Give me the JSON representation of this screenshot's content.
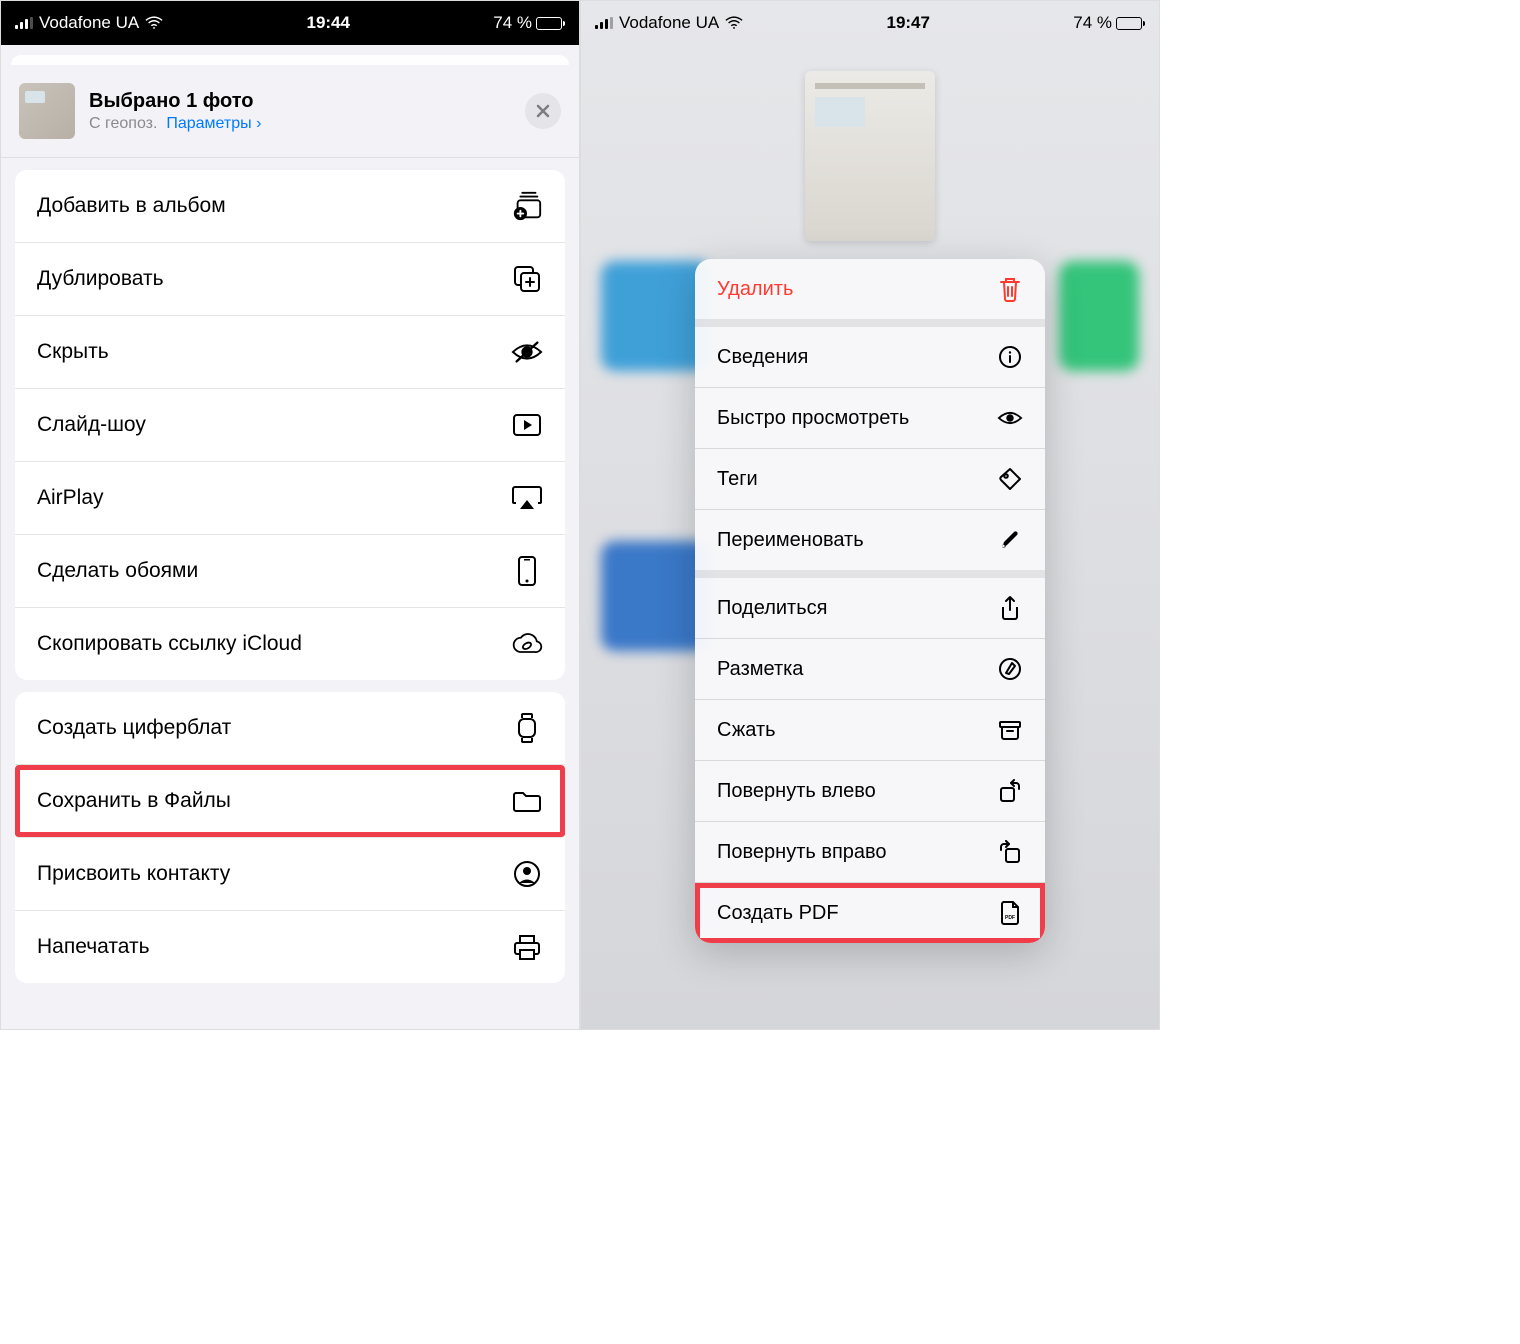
{
  "left": {
    "status": {
      "carrier": "Vodafone UA",
      "time": "19:44",
      "battery_pct": "74 %"
    },
    "header": {
      "title": "Выбрано 1 фото",
      "subtitle_prefix": "С геопоз.",
      "subtitle_link": "Параметры ›"
    },
    "groups": [
      [
        {
          "label": "Добавить в альбом",
          "icon": "add-album"
        },
        {
          "label": "Дублировать",
          "icon": "duplicate"
        },
        {
          "label": "Скрыть",
          "icon": "hide"
        },
        {
          "label": "Слайд-шоу",
          "icon": "slideshow"
        },
        {
          "label": "AirPlay",
          "icon": "airplay"
        },
        {
          "label": "Сделать обоями",
          "icon": "wallpaper"
        },
        {
          "label": "Скопировать ссылку iCloud",
          "icon": "icloud-link"
        }
      ],
      [
        {
          "label": "Создать циферблат",
          "icon": "watchface"
        },
        {
          "label": "Сохранить в Файлы",
          "icon": "folder",
          "highlight": true
        },
        {
          "label": "Присвоить контакту",
          "icon": "contact"
        },
        {
          "label": "Напечатать",
          "icon": "print"
        }
      ]
    ]
  },
  "right": {
    "status": {
      "carrier": "Vodafone UA",
      "time": "19:47",
      "battery_pct": "74 %"
    },
    "menu": [
      [
        {
          "label": "Удалить",
          "icon": "trash",
          "danger": true
        }
      ],
      [
        {
          "label": "Сведения",
          "icon": "info"
        },
        {
          "label": "Быстро просмотреть",
          "icon": "eye"
        },
        {
          "label": "Теги",
          "icon": "tag"
        },
        {
          "label": "Переименовать",
          "icon": "pencil"
        }
      ],
      [
        {
          "label": "Поделиться",
          "icon": "share"
        },
        {
          "label": "Разметка",
          "icon": "markup"
        },
        {
          "label": "Сжать",
          "icon": "archive"
        },
        {
          "label": "Повернуть влево",
          "icon": "rotate-left"
        },
        {
          "label": "Повернуть вправо",
          "icon": "rotate-right"
        },
        {
          "label": "Создать PDF",
          "icon": "pdf",
          "highlight": true
        }
      ]
    ]
  }
}
